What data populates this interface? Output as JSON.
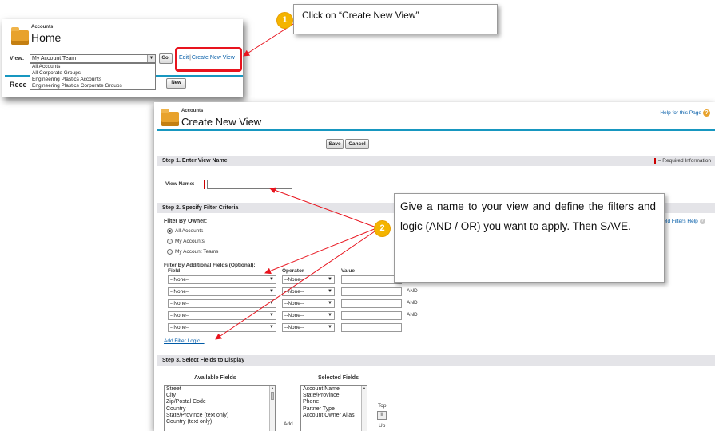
{
  "panel1": {
    "breadcrumb": "Accounts",
    "title": "Home",
    "view_label": "View:",
    "view_selected": "My Account Team",
    "go_label": "Go!",
    "edit_link": "Edit",
    "separator": "|",
    "create_link": "Create New View",
    "dropdown_options": [
      "All Accounts",
      "All Corporate Groups",
      "Engineering Plastics Accounts",
      "Engineering Plastics Corporate Groups"
    ],
    "recent_label": "Rece",
    "new_label": "New"
  },
  "panel2": {
    "breadcrumb": "Accounts",
    "title": "Create New View",
    "help_link": "Help for this Page",
    "save_label": "Save",
    "cancel_label": "Cancel",
    "required_info": "= Required Information",
    "step1": {
      "title": "Step 1. Enter View Name",
      "view_name_label": "View Name:",
      "view_name_value": ""
    },
    "step2": {
      "title": "Step 2. Specify Filter Criteria",
      "owner_title": "Filter By Owner:",
      "owner_options": [
        "All Accounts",
        "My Accounts",
        "My Account Teams"
      ],
      "owner_selected": "All Accounts",
      "filter_help": "Field Filters Help",
      "additional_title": "Filter By Additional Fields (Optional):",
      "col_field": "Field",
      "col_operator": "Operator",
      "col_value": "Value",
      "rows": [
        {
          "field": "--None--",
          "operator": "--None--",
          "value": "",
          "conj": ""
        },
        {
          "field": "--None--",
          "operator": "--None--",
          "value": "",
          "conj": "AND"
        },
        {
          "field": "--None--",
          "operator": "--None--",
          "value": "",
          "conj": "AND"
        },
        {
          "field": "--None--",
          "operator": "--None--",
          "value": "",
          "conj": "AND"
        },
        {
          "field": "--None--",
          "operator": "--None--",
          "value": "",
          "conj": ""
        }
      ],
      "add_filter_logic": "Add Filter Logic..."
    },
    "step3": {
      "title": "Step 3. Select Fields to Display",
      "available_title": "Available Fields",
      "selected_title": "Selected Fields",
      "available": [
        "Street",
        "City",
        "Zip/Postal Code",
        "Country",
        "State/Province (text only)",
        "Country (text only)"
      ],
      "selected": [
        "Account Name",
        "State/Province",
        "Phone",
        "Partner Type",
        "Account Owner Alias"
      ],
      "add_label": "Add",
      "top_label": "Top",
      "up_label": "Up"
    }
  },
  "callouts": {
    "one": {
      "number": "1",
      "text": "Click on “Create New View”"
    },
    "two": {
      "number": "2",
      "text": "Give a name to your view and define the filters and logic (AND / OR) you want to apply. Then SAVE."
    }
  },
  "colors": {
    "highlight": "#e8141e",
    "badge": "#f4b400",
    "link": "#015ba7",
    "accent_bar": "#1797c0"
  }
}
